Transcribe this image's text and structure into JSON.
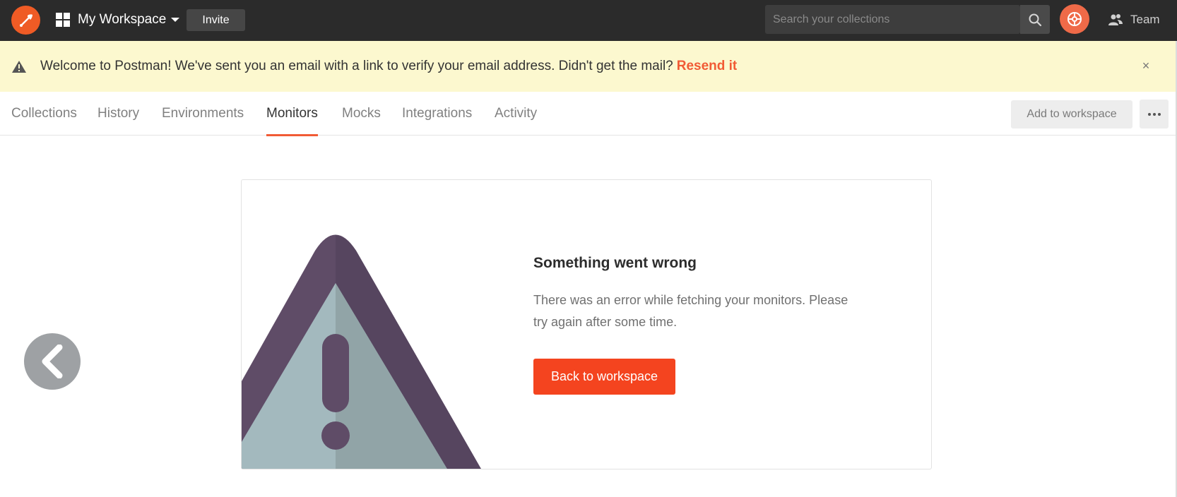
{
  "topbar": {
    "workspace_name": "My Workspace",
    "invite_label": "Invite",
    "search_placeholder": "Search your collections",
    "team_label": "Team"
  },
  "banner": {
    "message": "Welcome to Postman! We've sent you an email with a link to verify your email address. Didn't get the mail?",
    "link_label": "Resend it",
    "close_icon": "×"
  },
  "tabs": [
    {
      "label": "Collections"
    },
    {
      "label": "History"
    },
    {
      "label": "Environments"
    },
    {
      "label": "Monitors",
      "active": true
    },
    {
      "label": "Mocks"
    },
    {
      "label": "Integrations"
    },
    {
      "label": "Activity"
    }
  ],
  "actions": {
    "add_to_workspace_label": "Add to workspace"
  },
  "error": {
    "title": "Something went wrong",
    "message": "There was an error while fetching your monitors. Please try again after some time.",
    "button_label": "Back to workspace"
  },
  "colors": {
    "brand": "#ef5b25",
    "accent_button": "#f4441f",
    "banner_bg": "#fcf8cf",
    "topbar_bg": "#2b2b2b"
  },
  "icons": {
    "logo": "postman-rocket-icon",
    "workspace": "workspace-grid-icon",
    "search": "search-icon",
    "sync": "sync-satellite-icon",
    "team": "team-icon",
    "warning": "warning-triangle-icon",
    "more": "ellipsis-icon",
    "prev": "chevron-left-icon"
  }
}
